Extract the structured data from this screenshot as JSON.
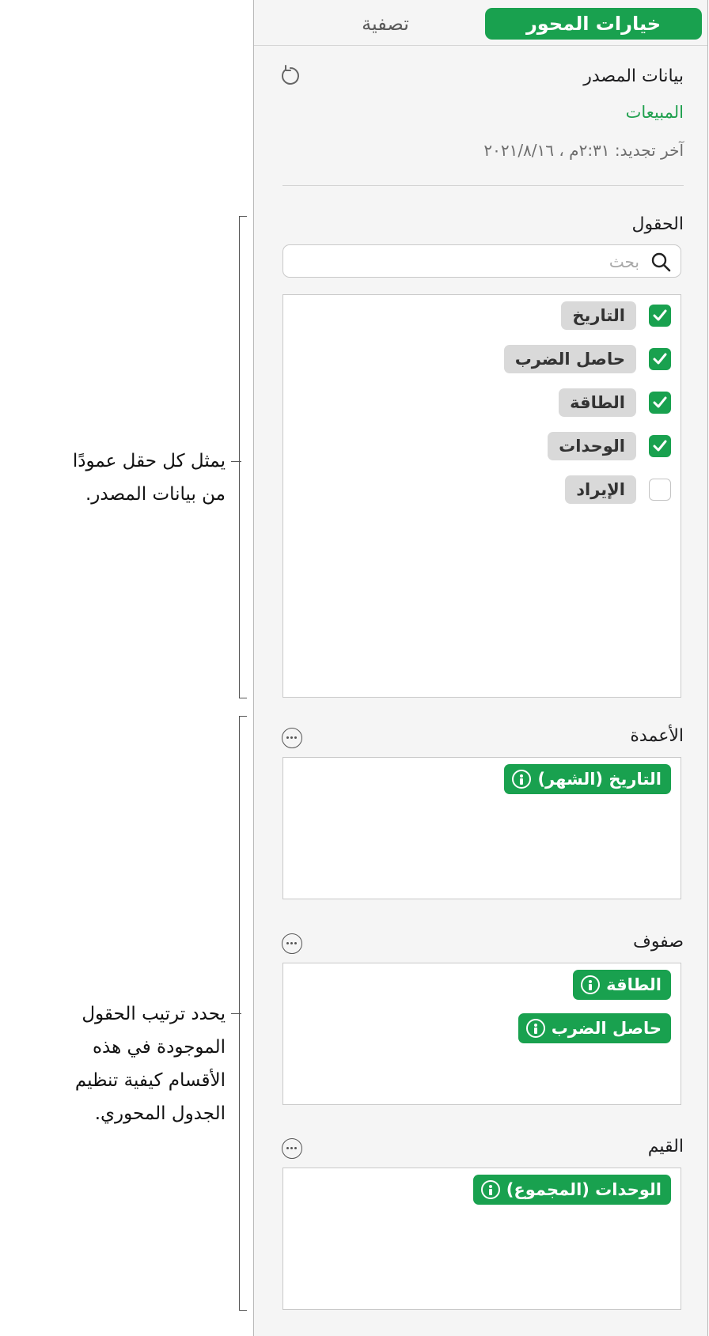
{
  "tabs": {
    "active": "خيارات المحور",
    "inactive": "تصفية"
  },
  "source": {
    "heading": "بيانات المصدر",
    "name": "المبيعات",
    "last_refresh": "آخر تجديد: ٢:٣١م ، ٢٠٢١/٨/١٦"
  },
  "fields": {
    "heading": "الحقول",
    "search_placeholder": "بحث",
    "items": [
      {
        "label": "التاريخ",
        "checked": true
      },
      {
        "label": "حاصل الضرب",
        "checked": true
      },
      {
        "label": "الطاقة",
        "checked": true
      },
      {
        "label": "الوحدات",
        "checked": true
      },
      {
        "label": "الإيراد",
        "checked": false
      }
    ]
  },
  "columns": {
    "heading": "الأعمدة",
    "pills": [
      "التاريخ (الشهر)"
    ]
  },
  "rows": {
    "heading": "صفوف",
    "pills": [
      "الطاقة",
      "حاصل الضرب"
    ]
  },
  "values": {
    "heading": "القيم",
    "pills": [
      "الوحدات (المجموع)"
    ]
  },
  "annotations": {
    "fields_note": [
      "يمثل كل حقل عمودًا",
      "من بيانات المصدر."
    ],
    "sections_note": [
      "يحدد ترتيب الحقول",
      "الموجودة في هذه",
      "الأقسام كيفية تنظيم",
      "الجدول المحوري."
    ]
  },
  "colors": {
    "accent": "#19a14f",
    "chip": "#d9d9d9",
    "panel": "#f5f5f5"
  },
  "icons": [
    "refresh-icon",
    "search-icon",
    "checkmark-icon",
    "more-icon",
    "info-icon"
  ]
}
